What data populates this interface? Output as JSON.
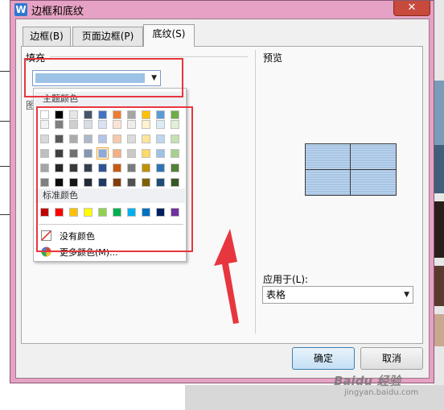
{
  "window": {
    "title": "边框和底纹",
    "close_symbol": "✕",
    "icon_letter": "W"
  },
  "tabs": [
    {
      "label": "边框(B)"
    },
    {
      "label": "页面边框(P)"
    },
    {
      "label": "底纹(S)",
      "active": true
    }
  ],
  "fill": {
    "label": "填充",
    "current_color": "#9cc2e5",
    "popup": {
      "theme_header": "主题颜色",
      "standard_header": "标准颜色",
      "no_color": "没有颜色",
      "more_colors": "更多颜色(M)...",
      "theme_rows": [
        [
          "#ffffff",
          "#000000",
          "#e7e6e6",
          "#44546a",
          "#4472c4",
          "#ed7d31",
          "#a5a5a5",
          "#ffc000",
          "#5b9bd5",
          "#70ad47"
        ],
        [
          "#f2f2f2",
          "#7f7f7f",
          "#d0cece",
          "#d6dce4",
          "#d9e2f3",
          "#fbe4d5",
          "#ededed",
          "#fff2cc",
          "#deebf6",
          "#e2efd9"
        ],
        [
          "#d8d8d8",
          "#595959",
          "#aeabab",
          "#adb9ca",
          "#b4c6e7",
          "#f7caac",
          "#dbdbdb",
          "#ffe599",
          "#bdd7ee",
          "#c5e0b3"
        ],
        [
          "#bfbfbf",
          "#3f3f3f",
          "#757070",
          "#8496b0",
          "#8eaadb",
          "#f4b083",
          "#c9c9c9",
          "#ffd966",
          "#9cc3e5",
          "#a8d08d"
        ],
        [
          "#a5a5a5",
          "#262626",
          "#3a3838",
          "#323f4f",
          "#2f5496",
          "#c55a11",
          "#7b7b7b",
          "#bf9000",
          "#2e75b5",
          "#538135"
        ],
        [
          "#7f7f7f",
          "#0c0c0c",
          "#171616",
          "#222a35",
          "#1f3864",
          "#833c0b",
          "#525252",
          "#7f6000",
          "#1e4d78",
          "#375623"
        ]
      ],
      "standard_colors": [
        "#c00000",
        "#ff0000",
        "#ffc000",
        "#ffff00",
        "#92d050",
        "#00b050",
        "#00b0f0",
        "#0070c0",
        "#002060",
        "#7030a0"
      ]
    }
  },
  "preview": {
    "label": "预览"
  },
  "apply_to": {
    "label": "应用于(L):",
    "value": "表格"
  },
  "buttons": {
    "ok": "确定",
    "cancel": "取消"
  },
  "watermark": {
    "text": "Baidu 经验",
    "sub": "jingyan.baidu.com"
  },
  "colors": {
    "title_bar": "#e6a2c4",
    "annotation_red": "#e8363e",
    "close_button": "#c84a3c"
  },
  "icons": [
    "word-app-icon",
    "close-icon",
    "dropdown-caret-icon",
    "no-color-icon",
    "color-wheel-icon"
  ]
}
